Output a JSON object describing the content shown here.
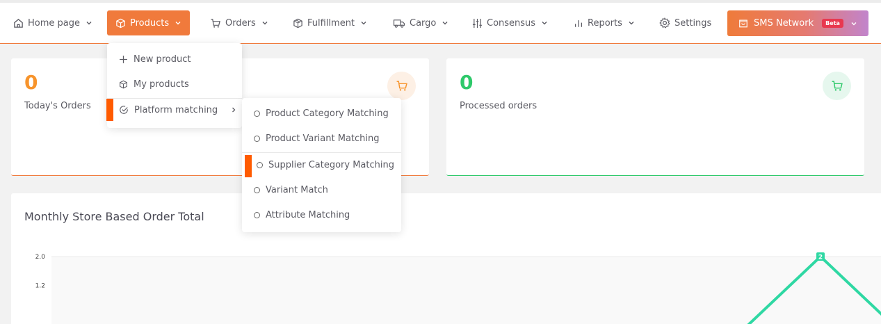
{
  "nav": {
    "items": [
      {
        "label": "Home page"
      },
      {
        "label": "Products"
      },
      {
        "label": "Orders"
      },
      {
        "label": "Fulfillment"
      },
      {
        "label": "Cargo"
      },
      {
        "label": "Consensus"
      },
      {
        "label": "Reports"
      },
      {
        "label": "Settings"
      }
    ],
    "sms": {
      "label": "SMS Network",
      "badge": "Beta"
    }
  },
  "stats": [
    {
      "value": "0",
      "label": "Today's Orders",
      "color": "#f7942c"
    },
    {
      "value": "0",
      "label": "Processed orders",
      "color": "#2ec96a"
    }
  ],
  "chart": {
    "title": "Monthly Store Based Order Total"
  },
  "products_menu": {
    "items": [
      {
        "label": "New product"
      },
      {
        "label": "My products"
      },
      {
        "label": "Platform matching"
      }
    ]
  },
  "submenu": {
    "items": [
      {
        "label": "Product Category Matching"
      },
      {
        "label": "Product Variant Matching"
      },
      {
        "label": "Supplier Category Matching"
      },
      {
        "label": "Variant Match"
      },
      {
        "label": "Attribute Matching"
      }
    ]
  },
  "chart_data": {
    "type": "line",
    "title": "Monthly Store Based Order Total",
    "ytick_labels": [
      "2.0",
      "1.2"
    ],
    "series": [
      {
        "values": [
          0,
          2,
          0
        ],
        "point_labels": [
          "",
          "2",
          ""
        ],
        "color": "#2fd8a3"
      }
    ],
    "ylim": [
      0,
      2
    ],
    "grid": false
  }
}
